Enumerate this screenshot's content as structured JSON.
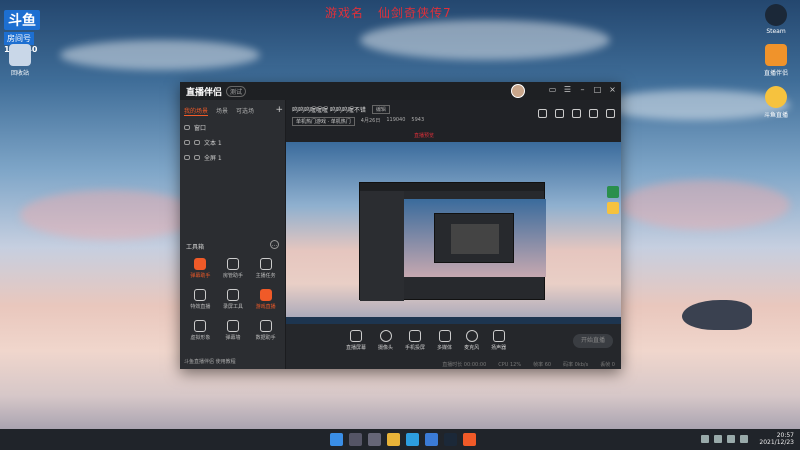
{
  "brand": {
    "logo_text": "斗鱼",
    "room_label": "房间号",
    "room_number": "119040"
  },
  "headline": {
    "part1": "游戏名",
    "part2": "仙剑奇侠传7"
  },
  "desktop_icons": [
    {
      "label": "回收站",
      "icon": "recycle-bin-icon"
    },
    {
      "label": "Steam",
      "icon": "steam-icon"
    },
    {
      "label": "直播伴侣",
      "icon": "help-box-icon"
    },
    {
      "label": "斗鱼直播",
      "icon": "mascot-icon"
    }
  ],
  "window": {
    "app_name": "直播伴侣",
    "version_badge": "测试",
    "scene_tabs": [
      "我的场景",
      "场景",
      "可选场"
    ],
    "scene_add": "+",
    "sources": [
      {
        "label": "窗口"
      },
      {
        "label": "文本 1"
      },
      {
        "label": "全屏 1"
      }
    ],
    "toolbox_title": "工具箱",
    "tools": [
      {
        "label": "弹幕助手",
        "hot": true
      },
      {
        "label": "房管助手",
        "hot": false
      },
      {
        "label": "主播任务",
        "hot": false
      },
      {
        "label": "特效直播",
        "hot": false
      },
      {
        "label": "录屏工具",
        "hot": false
      },
      {
        "label": "游戏直播",
        "hot": true
      },
      {
        "label": "虚拟形象",
        "hot": false
      },
      {
        "label": "弹幕墙",
        "hot": false
      },
      {
        "label": "数据助手",
        "hot": false
      }
    ],
    "sidebar_footer": "斗鱼直播伴侣 使用教程",
    "room_title": "呜呜呜喔喔喔 呜呜呜喔不错",
    "room_title_edit": "编辑",
    "room_category": "单机热门游戏 · 单机热门",
    "room_time": "4月26日",
    "room_id_meta": "119040",
    "room_heat": "5943",
    "live_label": "直播预览",
    "controls": [
      {
        "label": "直播屏幕",
        "icon": "screen-share-icon"
      },
      {
        "label": "摄像头",
        "icon": "camera-icon"
      },
      {
        "label": "手机投屏",
        "icon": "phone-cast-icon"
      },
      {
        "label": "多媒体",
        "icon": "media-icon"
      },
      {
        "label": "麦克风",
        "icon": "microphone-icon"
      },
      {
        "label": "扬声器",
        "icon": "speaker-icon"
      }
    ],
    "start_button": "开始直播",
    "status": [
      "直播时长 00:00:00",
      "CPU 12%",
      "帧率 60",
      "码率 0kb/s",
      "丢帧 0"
    ]
  },
  "taskbar": {
    "time": "20:57",
    "date": "2021/12/23"
  }
}
